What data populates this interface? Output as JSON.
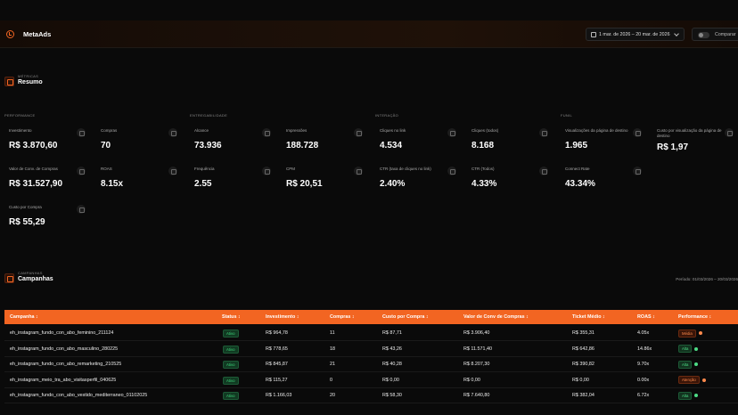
{
  "app": {
    "title": "MetaAds"
  },
  "header": {
    "date_range": "1 mar. de 2026 – 20 mar. de 2026",
    "compare_label": "Comparar"
  },
  "summary": {
    "kicker": "MÉTRICAS",
    "title": "Resumo",
    "groups": [
      {
        "label": "PERFORMANCE"
      },
      {
        "label": "ENTREGABILIDADE"
      },
      {
        "label": "INTERAÇÃO"
      },
      {
        "label": "FUNIL"
      }
    ],
    "cards": [
      {
        "label": "Investimento",
        "value": "R$ 3.870,60"
      },
      {
        "label": "Compras",
        "value": "70"
      },
      {
        "label": "Alcance",
        "value": "73.936"
      },
      {
        "label": "Impressões",
        "value": "188.728"
      },
      {
        "label": "Cliques no link",
        "value": "4.534"
      },
      {
        "label": "Cliques (todos)",
        "value": "8.168"
      },
      {
        "label": "Visualizações da página de destino",
        "value": "1.965"
      },
      {
        "label": "Custo por visualização da página de destino",
        "value": "R$ 1,97"
      },
      {
        "label": "Valor de Conv. de Compras",
        "value": "R$ 31.527,90"
      },
      {
        "label": "ROAS",
        "value": "8.15x"
      },
      {
        "label": "Frequência",
        "value": "2.55"
      },
      {
        "label": "CPM",
        "value": "R$ 20,51"
      },
      {
        "label": "CTR (taxa de cliques no link)",
        "value": "2.40%"
      },
      {
        "label": "CTR (Todos)",
        "value": "4.33%"
      },
      {
        "label": "Connect Rate",
        "value": "43.34%"
      },
      {
        "label": "Custo por Compra",
        "value": "R$ 55,29"
      }
    ]
  },
  "campaigns": {
    "kicker": "CAMPANHAS",
    "title": "Campanhas",
    "period": "Período: 01/03/2026 – 20/03/2026",
    "columns": [
      "Campanha",
      "Status",
      "Investimento",
      "Compras",
      "Custo por Compra",
      "Valor de Conv de Compras",
      "Ticket Médio",
      "ROAS",
      "Performance"
    ],
    "rows": [
      {
        "name": "eh_instagram_fundo_con_abo_feminino_211124",
        "status": "Ativo",
        "invest": "R$ 964,78",
        "compras": "11",
        "cpc": "R$ 87,71",
        "valor": "R$ 3.906,40",
        "ticket": "R$ 355,31",
        "roas": "4.05x",
        "perf": "Média",
        "perf_kind": "warn"
      },
      {
        "name": "eh_instagram_fundo_con_abo_masculino_280225",
        "status": "Ativo",
        "invest": "R$ 778,65",
        "compras": "18",
        "cpc": "R$ 43,26",
        "valor": "R$ 11.571,40",
        "ticket": "R$ 642,86",
        "roas": "14.86x",
        "perf": "Alta",
        "perf_kind": "ok"
      },
      {
        "name": "eh_instagram_fundo_con_abo_remarketing_210525",
        "status": "Ativo",
        "invest": "R$ 845,87",
        "compras": "21",
        "cpc": "R$ 40,28",
        "valor": "R$ 8.207,30",
        "ticket": "R$ 390,82",
        "roas": "9.70x",
        "perf": "Alta",
        "perf_kind": "ok"
      },
      {
        "name": "eh_instagram_meio_tra_abo_visitasperfil_040625",
        "status": "Ativo",
        "invest": "R$ 115,27",
        "compras": "0",
        "cpc": "R$ 0,00",
        "valor": "R$ 0,00",
        "ticket": "R$ 0,00",
        "roas": "0.00x",
        "perf": "Atenção",
        "perf_kind": "warn"
      },
      {
        "name": "eh_instagram_fundo_con_abo_vestido_mediterraneo_01102025",
        "status": "Ativo",
        "invest": "R$ 1.166,03",
        "compras": "20",
        "cpc": "R$ 58,30",
        "valor": "R$ 7.640,80",
        "ticket": "R$ 382,04",
        "roas": "6.72x",
        "perf": "Alta",
        "perf_kind": "ok"
      }
    ]
  }
}
